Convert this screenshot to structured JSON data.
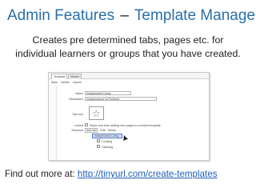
{
  "slide": {
    "title_main": "Admin Features",
    "title_dash": "–",
    "title_sub": "Template Manager",
    "subtitle_line1": "Creates pre determined tabs, pages etc. for",
    "subtitle_line2": "individual learners or groups that you have created.",
    "footer_label": "Find out more at:",
    "footer_link": "http://tinyurl.com/create-templates"
  },
  "screenshot": {
    "tabs": [
      "Template",
      "Viewer"
    ],
    "toolbar": [
      "Save",
      "Delete",
      "Cancel"
    ],
    "name_label": "Name",
    "name_value": "Independent Living",
    "description_label": "Description",
    "description_value": "Independence at Portland",
    "tab_icon_label": "Tab icon",
    "tab_icon": "star-icon",
    "locked_label": "Locked",
    "locked_text": "Stops user from adding new pages to a locked template",
    "structure_label": "Structure",
    "structure_buttons": [
      "Add tab",
      "Edit",
      "Delete"
    ],
    "tree": [
      "Independent Living",
      "Cooking",
      "Cleaning"
    ]
  },
  "colors": {
    "title": "#2a6fa8",
    "link": "#1f5fb8",
    "highlight": "#4a79c8"
  }
}
